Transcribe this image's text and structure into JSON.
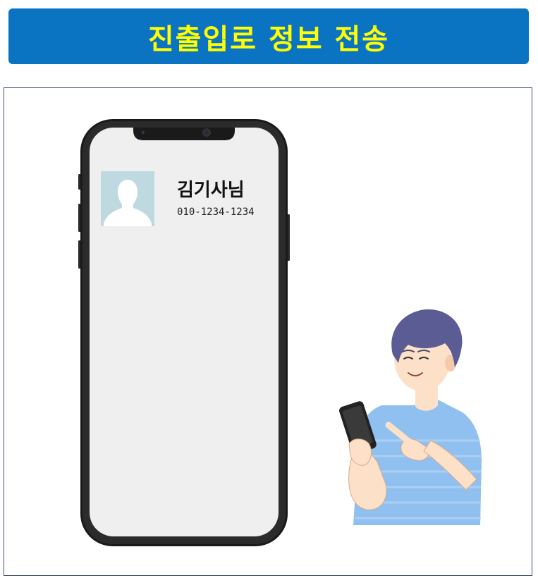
{
  "title": "진출입로 정보 전송",
  "contact": {
    "name": "김기사님",
    "phone": "010-1234-1234",
    "avatar_icon": "person-silhouette-icon"
  },
  "colors": {
    "banner": "#0b74c2",
    "title_text": "#ffff00",
    "frame_border": "#3d4f73",
    "phone_body": "#1a1a1a",
    "phone_screen": "#efefef",
    "avatar_bg": "#bfd9e0",
    "shirt": "#8fc0ef",
    "hair": "#5b5c94"
  },
  "illustration": {
    "device_icon": "smartphone-icon",
    "person_icon": "man-holding-phone-icon"
  }
}
